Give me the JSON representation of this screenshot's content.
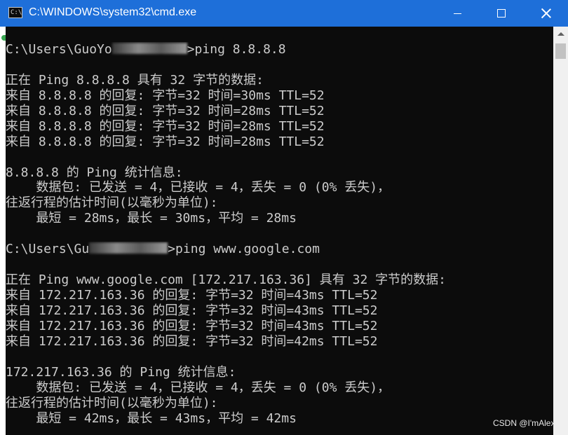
{
  "window": {
    "title": "C:\\WINDOWS\\system32\\cmd.exe",
    "icon_glyph": "C:\\",
    "controls": {
      "minimize": "minimize-icon",
      "maximize": "maximize-icon",
      "close": "close-icon"
    }
  },
  "console": {
    "lines": [
      "",
      "正在 Ping 8.8.8.8 具有 32 字节的数据:",
      "来自 8.8.8.8 的回复: 字节=32 时间=30ms TTL=52",
      "来自 8.8.8.8 的回复: 字节=32 时间=28ms TTL=52",
      "来自 8.8.8.8 的回复: 字节=32 时间=28ms TTL=52",
      "来自 8.8.8.8 的回复: 字节=32 时间=28ms TTL=52",
      "",
      "8.8.8.8 的 Ping 统计信息:",
      "    数据包: 已发送 = 4，已接收 = 4，丢失 = 0 (0% 丢失)，",
      "往返行程的估计时间(以毫秒为单位):",
      "    最短 = 28ms，最长 = 30ms，平均 = 28ms",
      "",
      "",
      "正在 Ping www.google.com [172.217.163.36] 具有 32 字节的数据:",
      "来自 172.217.163.36 的回复: 字节=32 时间=43ms TTL=52",
      "来自 172.217.163.36 的回复: 字节=32 时间=43ms TTL=52",
      "来自 172.217.163.36 的回复: 字节=32 时间=43ms TTL=52",
      "来自 172.217.163.36 的回复: 字节=32 时间=42ms TTL=52",
      "",
      "172.217.163.36 的 Ping 统计信息:",
      "    数据包: 已发送 = 4，已接收 = 4，丢失 = 0 (0% 丢失)，",
      "往返行程的估计时间(以毫秒为单位):",
      "    最短 = 42ms，最长 = 43ms，平均 = 42ms"
    ],
    "prompt1": {
      "before": "C:\\Users\\GuoYo",
      "after": ">ping 8.8.8.8"
    },
    "prompt2": {
      "before": "C:\\Users\\Gu",
      "after": ">ping www.google.com"
    }
  },
  "watermark": "CSDN @I'mAlex",
  "colors": {
    "titlebar": "#1e6fd9",
    "console_bg": "#0c0c0c",
    "console_text": "#cccccc"
  }
}
